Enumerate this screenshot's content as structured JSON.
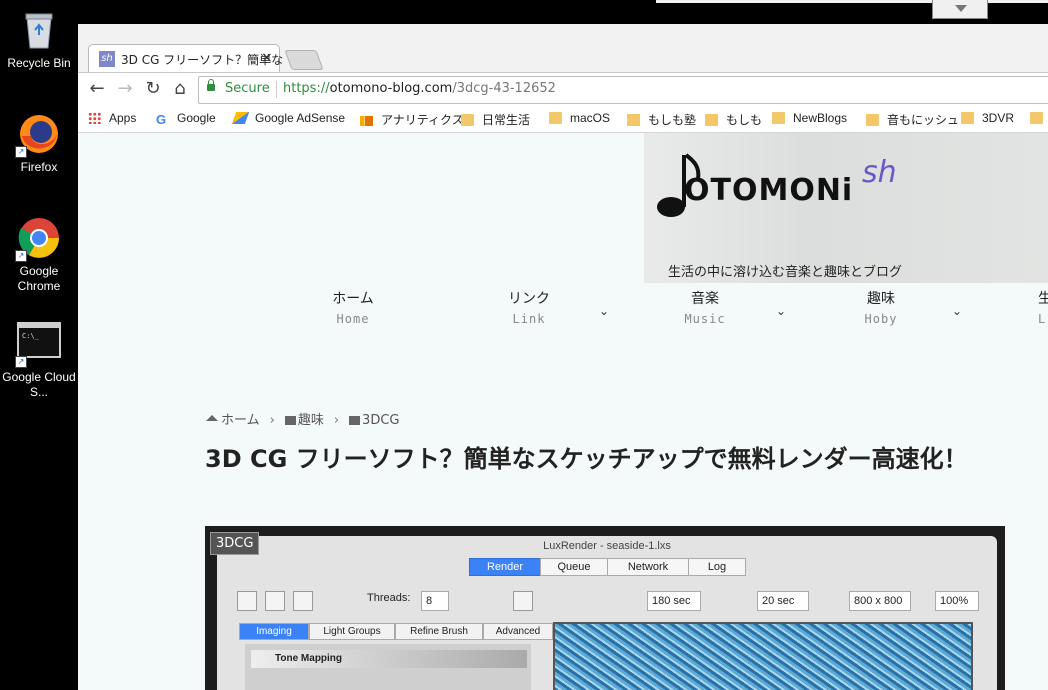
{
  "desktop": {
    "icons": [
      {
        "label": "Recycle Bin",
        "icon": "recycle-bin-icon"
      },
      {
        "label": "Firefox",
        "icon": "firefox-icon"
      },
      {
        "label": "Google Chrome",
        "icon": "chrome-icon"
      },
      {
        "label": "Google Cloud S...",
        "icon": "terminal-icon"
      }
    ]
  },
  "browser": {
    "tab": {
      "title": "3D CG フリーソフト？簡単な",
      "favicon": "sh",
      "close": "×"
    },
    "toolbar": {
      "back": "←",
      "forward": "→",
      "reload": "↻",
      "home": "⌂"
    },
    "address": {
      "secure_label": "Secure",
      "scheme": "https://",
      "host": "otomono-blog.com",
      "path": "/3dcg-43-12652"
    },
    "bookmarks": [
      {
        "label": "Apps",
        "icon": "apps-icon"
      },
      {
        "label": "Google",
        "icon": "google-icon"
      },
      {
        "label": "Google AdSense",
        "icon": "adsense-icon"
      },
      {
        "label": "アナリティクス",
        "icon": "analytics-icon"
      },
      {
        "label": "日常生活",
        "icon": "folder-icon"
      },
      {
        "label": "macOS",
        "icon": "folder-icon"
      },
      {
        "label": "もしも塾",
        "icon": "folder-icon"
      },
      {
        "label": "もしも",
        "icon": "folder-icon"
      },
      {
        "label": "NewBlogs",
        "icon": "folder-icon"
      },
      {
        "label": "音もにッシュ",
        "icon": "folder-icon"
      },
      {
        "label": "3DVR",
        "icon": "folder-icon"
      }
    ]
  },
  "site": {
    "logo_text": "OTOMONi",
    "logo_sh": "sh",
    "tagline": "生活の中に溶け込む音楽と趣味とブログ",
    "nav": [
      {
        "jp": "ホーム",
        "en": "Home",
        "dropdown": false
      },
      {
        "jp": "リンク",
        "en": "Link",
        "dropdown": true
      },
      {
        "jp": "音楽",
        "en": "Music",
        "dropdown": true
      },
      {
        "jp": "趣味",
        "en": "Hoby",
        "dropdown": true
      },
      {
        "jp": "生",
        "en": "L",
        "dropdown": false
      }
    ],
    "breadcrumb": [
      "ホーム",
      "趣味",
      "3DCG"
    ],
    "post_title": "3D CG フリーソフト？簡単なスケッチアップで無料レンダー高速化！",
    "image": {
      "category_tag": "3DCG",
      "window_title": "LuxRender - seaside-1.lxs",
      "tabs": [
        "Render",
        "Queue",
        "Network",
        "Log"
      ],
      "threads_label": "Threads:",
      "threads_value": "8",
      "time1": "180 sec",
      "time2": "20 sec",
      "resolution": "800 x 800",
      "zoom": "100%",
      "panel_tabs": [
        "Imaging",
        "Light Groups",
        "Refine Brush",
        "Advanced"
      ],
      "tone_mapping": "Tone Mapping"
    }
  }
}
